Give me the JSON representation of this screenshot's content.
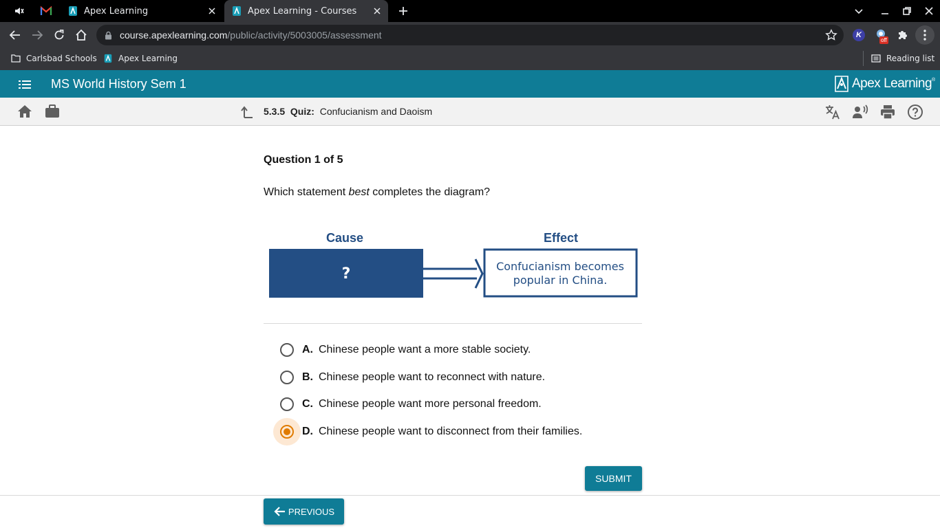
{
  "browser": {
    "tabs": [
      {
        "label": "Apex Learning"
      },
      {
        "label": "Apex Learning - Courses"
      }
    ],
    "url_host": "course.apexlearning.com",
    "url_path": "/public/activity/5003005/assessment",
    "extension_badge": "off",
    "extension_k": "K",
    "bookmarks": [
      {
        "label": "Carlsbad Schools"
      },
      {
        "label": "Apex Learning"
      }
    ],
    "reading_list": "Reading list"
  },
  "app": {
    "course_title": "MS World History Sem 1",
    "brand": "Apex Learning",
    "brand_mark": "®",
    "activity_number": "5.3.5",
    "activity_type": "Quiz:",
    "activity_title": "Confucianism and Daoism"
  },
  "question": {
    "heading": "Question 1 of 5",
    "prompt_before": "Which statement ",
    "prompt_emphasis": "best",
    "prompt_after": " completes the diagram?",
    "diagram": {
      "cause_label": "Cause",
      "effect_label": "Effect",
      "cause_text": "?",
      "effect_line1": "Confucianism becomes",
      "effect_line2": "popular in China."
    },
    "options": [
      {
        "letter": "A.",
        "text": "Chinese people want a more stable society."
      },
      {
        "letter": "B.",
        "text": "Chinese people want to reconnect with nature."
      },
      {
        "letter": "C.",
        "text": "Chinese people want more personal freedom."
      },
      {
        "letter": "D.",
        "text": "Chinese people want to disconnect from their families."
      }
    ],
    "selected": "D.",
    "submit_label": "SUBMIT",
    "previous_label": "PREVIOUS"
  },
  "colors": {
    "teal": "#0f7c96",
    "diagram_blue": "#234e84",
    "selected_orange": "#e07b00"
  }
}
